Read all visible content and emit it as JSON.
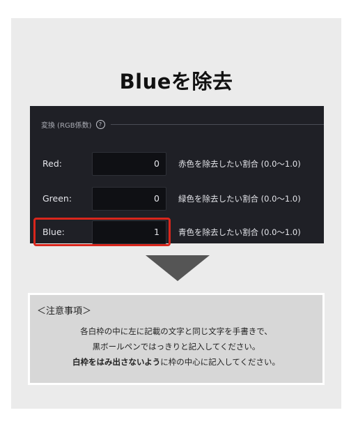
{
  "title": "Blueを除去",
  "panel": {
    "section_label": "変換 (RGB係数)",
    "help_icon": "?",
    "rows": [
      {
        "label": "Red:",
        "value": "0",
        "description": "赤色を除去したい割合 (0.0〜1.0)"
      },
      {
        "label": "Green:",
        "value": "0",
        "description": "緑色を除去したい割合 (0.0〜1.0)"
      },
      {
        "label": "Blue:",
        "value": "1",
        "description": "青色を除去したい割合 (0.0〜1.0)"
      }
    ]
  },
  "notice": {
    "heading": "＜注意事項＞",
    "line1": "各白枠の中に左に記載の文字と同じ文字を手書きで、",
    "line2": "黒ボールペンではっきりと記入してください。",
    "line3_bold": "白枠をはみ出さないよう",
    "line3_rest": "に枠の中心に記入してください。"
  },
  "colors": {
    "panel_background": "#1f2026",
    "highlight": "#d9261c",
    "arrow": "#555555",
    "card_background": "#ebebeb"
  }
}
